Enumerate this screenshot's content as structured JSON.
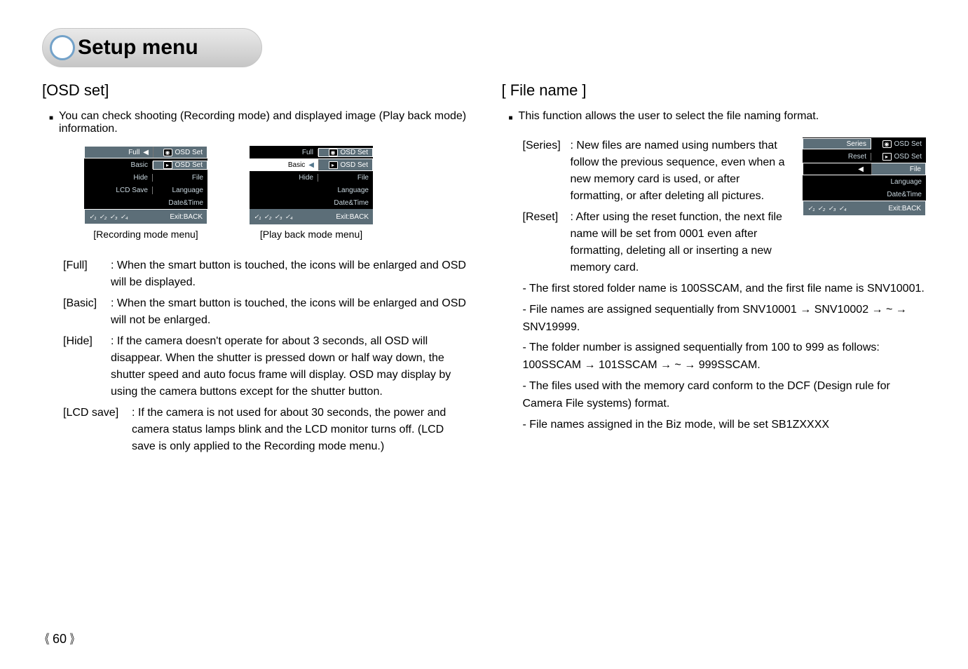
{
  "title": "Setup menu",
  "page_number": "60",
  "left": {
    "heading": "[OSD set]",
    "intro": "You can check shooting (Recording mode) and displayed image (Play back mode) information.",
    "rec_caption": "[Recording mode menu]",
    "play_caption": "[Play back mode menu]",
    "lcd": {
      "full": "Full",
      "basic": "Basic",
      "hide": "Hide",
      "lcdsave": "LCD Save",
      "osdset": "OSD Set",
      "file": "File",
      "language": "Language",
      "datetime": "Date&Time",
      "exit": "Exit:BACK"
    },
    "defs": {
      "full_lbl": "[Full]",
      "full_txt": ": When the smart button is touched, the icons will be enlarged and OSD will be displayed.",
      "basic_lbl": "[Basic]",
      "basic_txt": ": When the smart button is touched, the icons will be enlarged and OSD will not be enlarged.",
      "hide_lbl": "[Hide]",
      "hide_txt": ": If the camera doesn't operate for about 3 seconds, all OSD will disappear. When the shutter is pressed down or half way down, the shutter speed and auto focus frame will display. OSD may display by using the camera buttons except for the shutter button.",
      "lcd_lbl": "[LCD save]",
      "lcd_txt": ": If the camera is not used for about 30 seconds, the power and camera status lamps blink and the LCD monitor turns off. (LCD save is only applied to the Recording mode menu.)"
    }
  },
  "right": {
    "heading": "[ File name ]",
    "intro": "This function allows the user to select the file naming format.",
    "lcd": {
      "series": "Series",
      "reset": "Reset",
      "osdset": "OSD Set",
      "file": "File",
      "language": "Language",
      "datetime": "Date&Time",
      "exit": "Exit:BACK"
    },
    "defs": {
      "series_lbl": "[Series]",
      "series_txt": ": New files are named using numbers that follow the previous sequence, even when a new memory card is used, or after formatting, or after deleting all pictures.",
      "reset_lbl": "[Reset]",
      "reset_txt": ": After using the reset function, the next file name will be set from 0001 even after formatting, deleting all or inserting a new memory card."
    },
    "details": {
      "d1": "- The first stored folder name is 100SSCAM, and the first file name is SNV10001.",
      "d2": "- File names are assigned sequentially from SNV10001 → SNV10002 → ~ → SNV19999.",
      "d3": "- The folder number is assigned sequentially from 100 to 999 as follows: 100SSCAM → 101SSCAM → ~ → 999SSCAM.",
      "d4": "- The files used with the memory card conform to the DCF (Design rule for Camera File systems) format.",
      "d5": "- File names assigned in the Biz mode, will be set SB1ZXXXX"
    }
  }
}
